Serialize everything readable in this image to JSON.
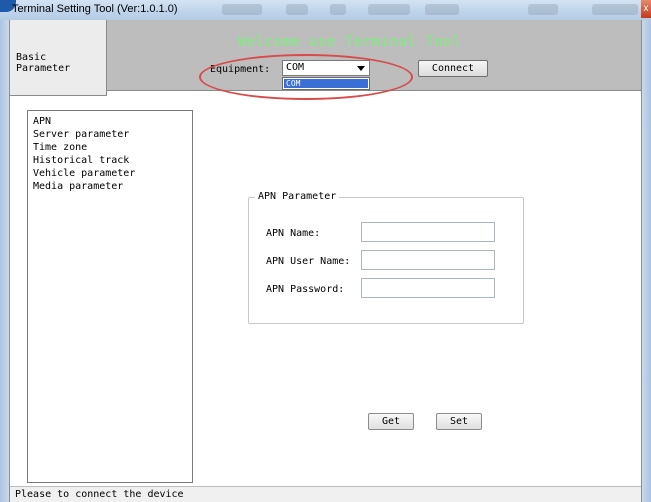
{
  "window": {
    "title": "Terminal Setting Tool  (Ver:1.0.1.0)",
    "close_glyph": "x"
  },
  "header": {
    "basic_tab_label": "Basic Parameter",
    "welcome_text": "Welcome use Terminal Tool",
    "equipment_label": "Equipment:",
    "equipment_value": "COM",
    "dropdown_options": [
      "COM"
    ],
    "connect_label": "Connect"
  },
  "sidebar": {
    "items": [
      {
        "label": "APN"
      },
      {
        "label": "Server parameter"
      },
      {
        "label": "Time zone"
      },
      {
        "label": "Historical track"
      },
      {
        "label": "Vehicle parameter"
      },
      {
        "label": "Media parameter"
      }
    ]
  },
  "apn": {
    "group_title": "APN Parameter",
    "fields": [
      {
        "label": "APN Name:",
        "value": ""
      },
      {
        "label": "APN User Name:",
        "value": ""
      },
      {
        "label": "APN Password:",
        "value": ""
      }
    ],
    "get_label": "Get",
    "set_label": "Set"
  },
  "status": {
    "text": "Please to connect the device"
  },
  "colors": {
    "welcome_text": "#7cf07a",
    "header_bg": "#bdbdbd",
    "annotation": "#d94b4b",
    "selection": "#3a6fd6"
  },
  "icons": {
    "app": "app-logo-icon",
    "dropdown": "chevron-down-icon",
    "close": "close-icon"
  }
}
